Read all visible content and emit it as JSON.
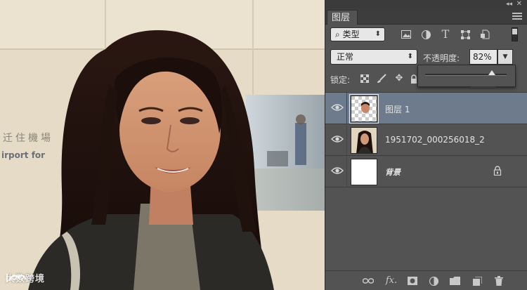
{
  "photo": {
    "sign_cn": "迁住機場",
    "sign_en": "irport for",
    "watermark_text": "大数跨境"
  },
  "panel": {
    "tab_label": "图层",
    "filter": {
      "kind_label": "类型",
      "selected_icon": "search-icon"
    },
    "blend_mode": "正常",
    "opacity_label": "不透明度:",
    "opacity_value": "82%",
    "opacity_fraction": 0.82,
    "lock_label": "锁定:",
    "layers": [
      {
        "name": "图层 1",
        "selected": true,
        "visible": true,
        "style": "normal"
      },
      {
        "name": "1951702_000256018_2",
        "selected": false,
        "visible": true,
        "style": "normal"
      },
      {
        "name": "背景",
        "selected": false,
        "visible": true,
        "style": "italic",
        "locked": true
      }
    ],
    "colors": {
      "panel_bg": "#535353",
      "selected_row": "#6e7b8d",
      "tab_bar": "#3d3d3d"
    }
  }
}
